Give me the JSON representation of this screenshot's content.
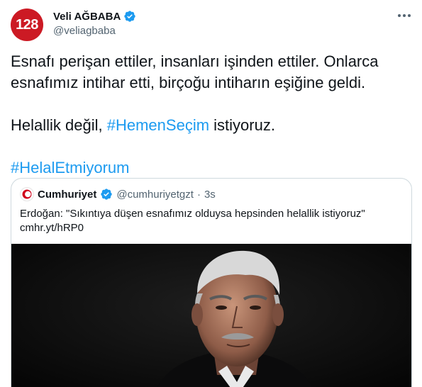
{
  "author": {
    "avatar_text": "128",
    "display_name": "Veli AĞBABA",
    "handle": "@veliagbaba"
  },
  "tweet": {
    "line1": "Esnafı perişan ettiler, insanları işinden ettiler. Onlarca",
    "line2": "esnafımız intihar etti, birçoğu intiharın eşiğine geldi.",
    "line3_before": "Helallik değil,",
    "line3_hashtag": "#HemenSeçim",
    "line3_after": "istiyoruz.",
    "hashtag2": "#HelalEtmiyorum"
  },
  "quote": {
    "display_name": "Cumhuriyet",
    "handle": "@cumhuriyetgzt",
    "dot": "·",
    "time": "3s",
    "text": "Erdoğan: \"Sıkıntıya düşen esnafımız olduysa hepsinden helallik istiyoruz\"",
    "link": "cmhr.yt/hRP0"
  },
  "icons": {
    "verified": "verified-badge-icon",
    "more": "more-options-icon",
    "quote_logo": "cumhuriyet-logo-icon"
  },
  "colors": {
    "accent": "#1d9bf0",
    "avatar_bg": "#cc1a24",
    "secondary_text": "#536471"
  }
}
